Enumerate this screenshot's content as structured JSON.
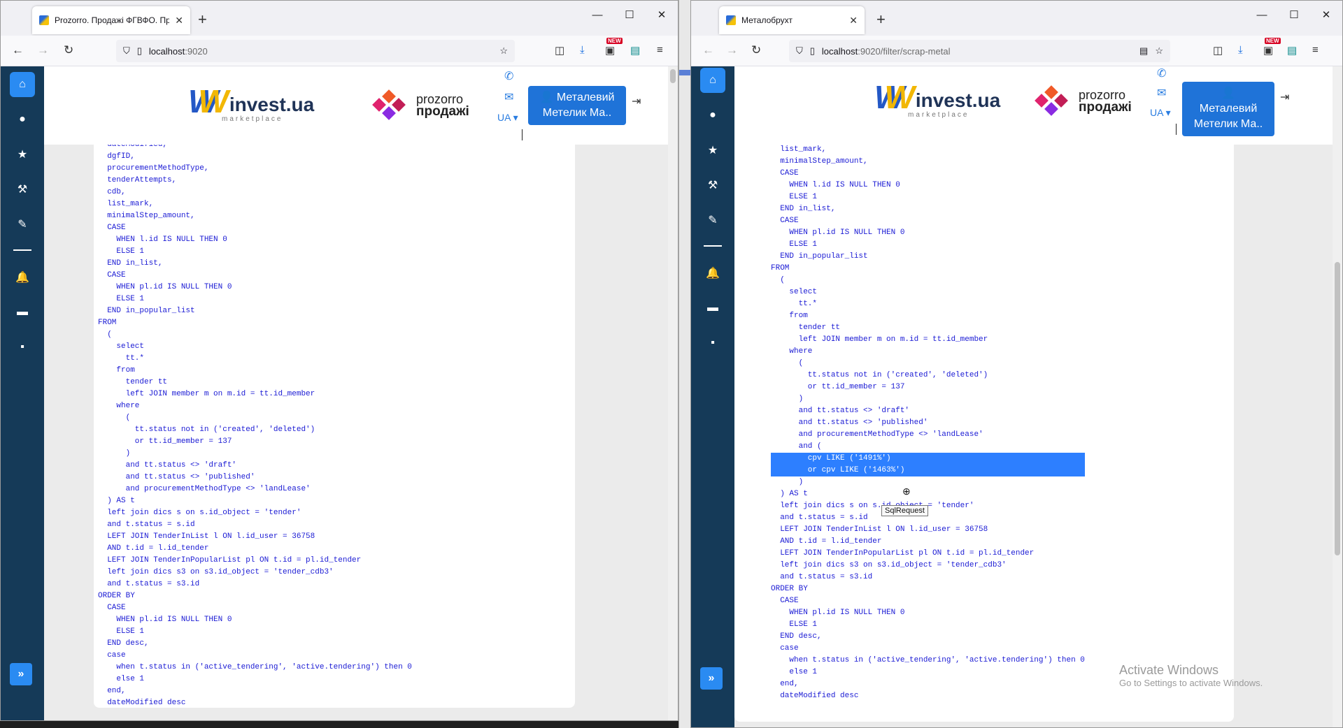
{
  "left_window": {
    "tab_title": "Prozorro. Продажі ФГВФО. Пр",
    "url_host": "localhost",
    "url_port": ":9020"
  },
  "right_window": {
    "tab_title": "Металобрухт",
    "url_host": "localhost",
    "url_port": ":9020/filter/scrap-metal"
  },
  "browser": {
    "new_tab": "+",
    "close": "✕",
    "minimize": "—",
    "maximize": "☐",
    "back": "←",
    "forward": "→",
    "reload": "↻",
    "new_badge": "NEW"
  },
  "site": {
    "logo_text": "invest.ua",
    "logo_sub": "marketplace",
    "prozorro_line1": "prozorro",
    "prozorro_line2": "продажі",
    "lang": "UA ▾",
    "user_line1": "👤 Металевий",
    "user_line2": "Метелик Ма..",
    "logout": "⇥"
  },
  "icons": {
    "home": "⌂",
    "user": "●",
    "star": "★",
    "gavel": "⚒",
    "pen": "✎",
    "bell": "🔔",
    "money": "▬",
    "note": "▪",
    "expand": "»",
    "phone": "✆",
    "mail": "✉"
  },
  "left_sql": [
    "  dateModified,",
    "  dgfID,",
    "  procurementMethodType,",
    "  tenderAttempts,",
    "  cdb,",
    "  list_mark,",
    "  minimalStep_amount,",
    "  CASE",
    "    WHEN l.id IS NULL THEN 0",
    "    ELSE 1",
    "  END in_list,",
    "  CASE",
    "    WHEN pl.id IS NULL THEN 0",
    "    ELSE 1",
    "  END in_popular_list",
    "FROM",
    "  (",
    "    select",
    "      tt.*",
    "    from",
    "      tender tt",
    "      left JOIN member m on m.id = tt.id_member",
    "    where",
    "      (",
    "        tt.status not in ('created', 'deleted')",
    "        or tt.id_member = 137",
    "      )",
    "      and tt.status <> 'draft'",
    "      and tt.status <> 'published'",
    "      and procurementMethodType <> 'landLease'",
    "  ) AS t",
    "  left join dics s on s.id_object = 'tender'",
    "  and t.status = s.id",
    "  LEFT JOIN TenderInList l ON l.id_user = 36758",
    "  AND t.id = l.id_tender",
    "  LEFT JOIN TenderInPopularList pl ON t.id = pl.id_tender",
    "  left join dics s3 on s3.id_object = 'tender_cdb3'",
    "  and t.status = s3.id",
    "ORDER BY",
    "  CASE",
    "    WHEN pl.id IS NULL THEN 0",
    "    ELSE 1",
    "  END desc,",
    "  case",
    "    when t.status in ('active_tendering', 'active.tendering') then 0",
    "    else 1",
    "  end,",
    "  dateModified desc"
  ],
  "right_sql": [
    "  cdb,",
    "  list_mark,",
    "  minimalStep_amount,",
    "  CASE",
    "    WHEN l.id IS NULL THEN 0",
    "    ELSE 1",
    "  END in_list,",
    "  CASE",
    "    WHEN pl.id IS NULL THEN 0",
    "    ELSE 1",
    "  END in_popular_list",
    "FROM",
    "  (",
    "    select",
    "      tt.*",
    "    from",
    "      tender tt",
    "      left JOIN member m on m.id = tt.id_member",
    "    where",
    "      (",
    "        tt.status not in ('created', 'deleted')",
    "        or tt.id_member = 137",
    "      )",
    "      and tt.status <> 'draft'",
    "      and tt.status <> 'published'",
    "      and procurementMethodType <> 'landLease'",
    "      and (",
    "        cpv LIKE ('1491%')",
    "        or cpv LIKE ('1463%')",
    "      )",
    "  ) AS t",
    "  left join dics s on s.id_object = 'tender'",
    "  and t.status = s.id",
    "  LEFT JOIN TenderInList l ON l.id_user = 36758",
    "  AND t.id = l.id_tender",
    "  LEFT JOIN TenderInPopularList pl ON t.id = pl.id_tender",
    "  left join dics s3 on s3.id_object = 'tender_cdb3'",
    "  and t.status = s3.id",
    "ORDER BY",
    "  CASE",
    "    WHEN pl.id IS NULL THEN 0",
    "    ELSE 1",
    "  END desc,",
    "  case",
    "    when t.status in ('active_tendering', 'active.tendering') then 0",
    "    else 1",
    "  end,",
    "  dateModified desc"
  ],
  "highlighted_lines": [
    27,
    28
  ],
  "tooltip": "SqlRequest",
  "watermark": {
    "title": "Activate Windows",
    "subtitle": "Go to Settings to activate Windows."
  }
}
